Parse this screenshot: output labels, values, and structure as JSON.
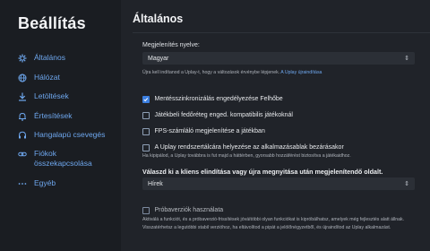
{
  "sidebar": {
    "title": "Beállítás",
    "items": [
      {
        "label": "Általános",
        "icon": "gear-icon"
      },
      {
        "label": "Hálózat",
        "icon": "globe-icon"
      },
      {
        "label": "Letöltések",
        "icon": "download-icon"
      },
      {
        "label": "Értesítések",
        "icon": "bell-icon"
      },
      {
        "label": "Hangalapú csevegés",
        "icon": "headset-icon"
      },
      {
        "label": "Fiókok összekapcsolása",
        "icon": "link-icon"
      },
      {
        "label": "Egyéb",
        "icon": "more-icon"
      }
    ]
  },
  "main": {
    "title": "Általános",
    "language": {
      "label": "Megjelenítés nyelve:",
      "value": "Magyar",
      "note": "Újra kell indítanod a Uplay-t, hogy a változások érvénybe lépjenek.",
      "restart_link": "A Uplay újraindítása"
    },
    "options": [
      {
        "label": "Mentésszinkronizálás engedélyezése Felhőbe",
        "checked": true
      },
      {
        "label": "Játékbeli fedőréteg enged. kompatibilis játékoknál",
        "checked": false
      },
      {
        "label": "FPS-számláló megjelenítése a játékban",
        "checked": false
      },
      {
        "label": "A Uplay rendszertálcára helyezése az alkalmazásablak bezárásakor",
        "checked": false
      }
    ],
    "tray_note": "Ha kipipálod, a Uplay továbbra is fut majd a háttérben, gyorsabb hozzáférést biztosítva a játékaidhoz.",
    "startup": {
      "label": "Válaszd ki a kliens elindítása vagy újra megnyitása után megjelenítendő oldalt.",
      "value": "Hírek"
    },
    "beta": {
      "label": "Próbaverziók használata",
      "checked": false,
      "note": "Aktiválá a funkciót, és a próbaverzió-frissítések jóváítóbbi olyan funkciókat is kipróbálhatsz, amelyek még fejlesztés alatt állnak. Visszatérhetsz a legutóbbi stabil verzióhoz, ha eltávolítod a pipát a jelölőnégyzetből, és újraindítod az Uplay alkalmazást."
    }
  },
  "colors": {
    "accent": "#3c7fe0",
    "link": "#6ea7ee",
    "sidebar_bg": "#1a1d22",
    "main_bg": "#202329"
  }
}
